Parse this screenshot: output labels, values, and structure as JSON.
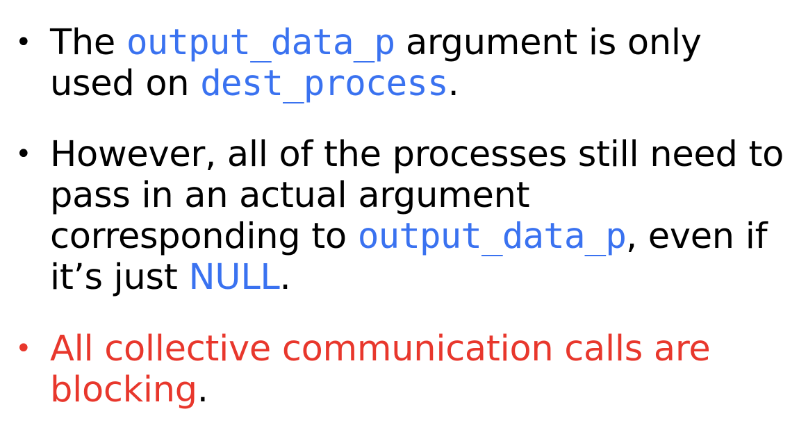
{
  "bullets": [
    {
      "segments": [
        {
          "text": "The ",
          "style": "plain"
        },
        {
          "text": "output_data_p",
          "style": "code"
        },
        {
          "text": " argument is only used on ",
          "style": "plain"
        },
        {
          "text": "dest_process",
          "style": "code"
        },
        {
          "text": ".",
          "style": "plain"
        }
      ]
    },
    {
      "segments": [
        {
          "text": "However, all of the processes still need to pass in an actual argument corresponding to ",
          "style": "plain"
        },
        {
          "text": "output_data_p",
          "style": "code"
        },
        {
          "text": ", even if it’s just ",
          "style": "plain"
        },
        {
          "text": "NULL",
          "style": "kw"
        },
        {
          "text": ".",
          "style": "plain"
        }
      ]
    },
    {
      "segments": [
        {
          "text": "All collective communication calls are blocking",
          "style": "plain"
        },
        {
          "text": ".",
          "style": "plain"
        }
      ]
    }
  ],
  "colors": {
    "code": "#3a72f0",
    "emphasis": "#e8372c",
    "text": "#000000",
    "background": "#ffffff"
  }
}
